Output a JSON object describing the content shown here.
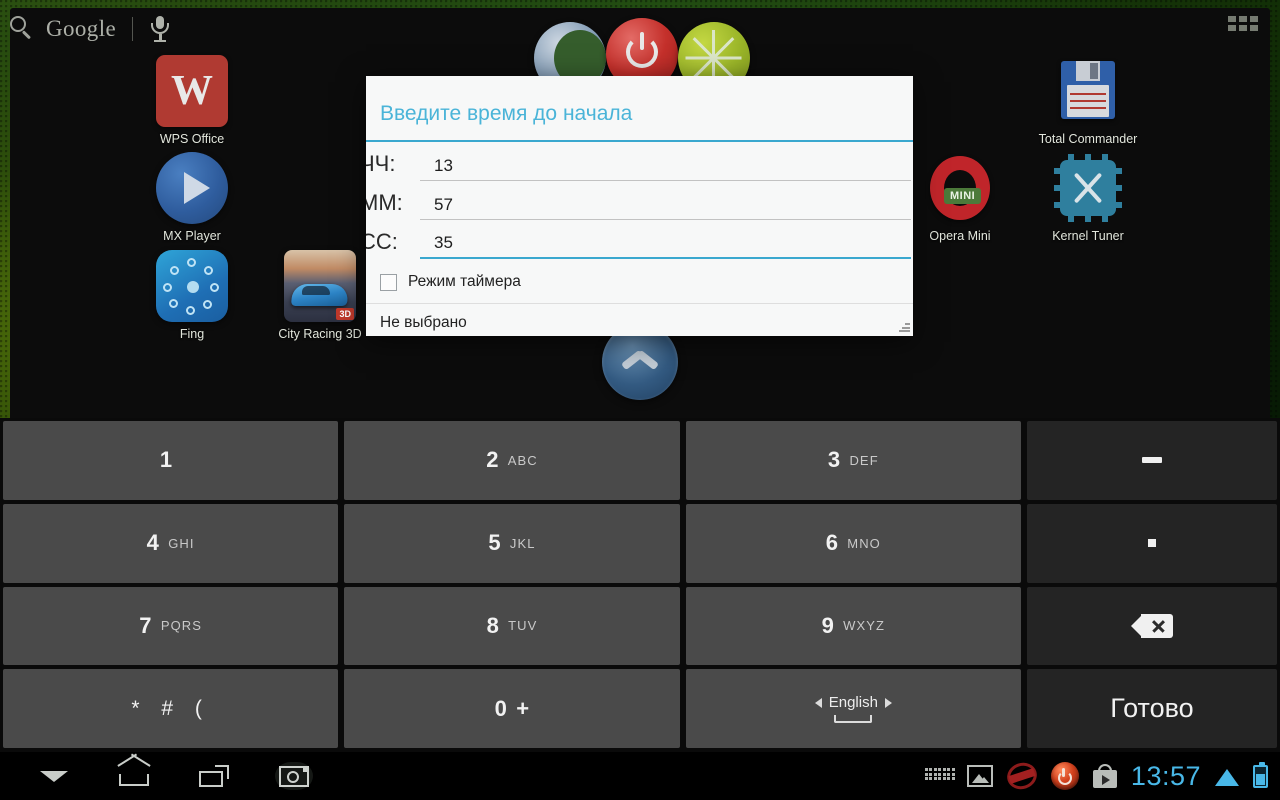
{
  "search": {
    "brand": "Google",
    "search_icon": "search-icon",
    "mic_icon": "microphone-icon"
  },
  "drawer": {
    "icon": "apps-grid-icon"
  },
  "desktop": {
    "icons": [
      {
        "label": "WPS Office",
        "name": "app-icon-wps-office"
      },
      {
        "label": "MX Player",
        "name": "app-icon-mx-player"
      },
      {
        "label": "Fing",
        "name": "app-icon-fing"
      },
      {
        "label": "City Racing 3D",
        "name": "app-icon-city-racing-3d",
        "badge": "3D"
      },
      {
        "label": "Total Commander",
        "name": "app-icon-total-commander"
      },
      {
        "label": "Opera Mini",
        "name": "app-icon-opera-mini",
        "badge": "MINI"
      },
      {
        "label": "Kernel Tuner",
        "name": "app-icon-kernel-tuner"
      }
    ],
    "dock_handle_icon": "chevron-up-icon"
  },
  "dialog": {
    "title": "Введите время до начала",
    "fields": [
      {
        "label": "ЧЧ:",
        "value": "13",
        "active": false
      },
      {
        "label": "ММ:",
        "value": "57",
        "active": false
      },
      {
        "label": "СС:",
        "value": "35",
        "active": true
      }
    ],
    "checkbox": {
      "label": "Режим таймера",
      "checked": false
    },
    "footer_text": "Не выбрано",
    "resize_icon": "resize-grip-icon",
    "accent_color": "#3aa8cf",
    "title_color": "#4ab4d8"
  },
  "keyboard": {
    "rows": [
      [
        {
          "digit": "1",
          "sub": "",
          "type": "num",
          "name": "key-1"
        },
        {
          "digit": "2",
          "sub": "ABC",
          "type": "num",
          "name": "key-2"
        },
        {
          "digit": "3",
          "sub": "DEF",
          "type": "num",
          "name": "key-3"
        },
        {
          "digit": "",
          "sub": "",
          "type": "side",
          "glyph": "dash-icon",
          "name": "key-dash"
        }
      ],
      [
        {
          "digit": "4",
          "sub": "GHI",
          "type": "num",
          "name": "key-4"
        },
        {
          "digit": "5",
          "sub": "JKL",
          "type": "num",
          "name": "key-5"
        },
        {
          "digit": "6",
          "sub": "MNO",
          "type": "num",
          "name": "key-6"
        },
        {
          "digit": "",
          "sub": "",
          "type": "side",
          "glyph": "period-icon",
          "name": "key-period"
        }
      ],
      [
        {
          "digit": "7",
          "sub": "PQRS",
          "type": "num",
          "name": "key-7"
        },
        {
          "digit": "8",
          "sub": "TUV",
          "type": "num",
          "name": "key-8"
        },
        {
          "digit": "9",
          "sub": "WXYZ",
          "type": "num",
          "name": "key-9"
        },
        {
          "digit": "",
          "sub": "",
          "type": "side",
          "glyph": "backspace-icon",
          "name": "key-backspace"
        }
      ],
      [
        {
          "digit": "",
          "sub": "",
          "type": "num",
          "sym": "* # (",
          "name": "key-symbols"
        },
        {
          "digit": "0",
          "sub": "+",
          "type": "num",
          "name": "key-0"
        },
        {
          "digit": "",
          "sub": "",
          "type": "num",
          "lang": "English",
          "name": "key-language"
        },
        {
          "digit": "",
          "sub": "",
          "type": "side",
          "done": "Готово",
          "name": "key-done"
        }
      ]
    ],
    "language_label": "English"
  },
  "systembar": {
    "nav": [
      {
        "name": "nav-back-hide-keyboard",
        "icon": "chevron-down-icon"
      },
      {
        "name": "nav-home",
        "icon": "home-icon"
      },
      {
        "name": "nav-recent-apps",
        "icon": "recent-apps-icon"
      },
      {
        "name": "nav-screenshot",
        "icon": "camera-icon"
      }
    ],
    "status_icons": [
      {
        "name": "status-keyboard",
        "icon": "keyboard-icon"
      },
      {
        "name": "status-screenshot",
        "icon": "image-icon"
      },
      {
        "name": "status-update",
        "icon": "update-stamp-icon"
      },
      {
        "name": "status-reboot",
        "icon": "power-button-icon"
      },
      {
        "name": "status-play-store",
        "icon": "play-store-icon"
      }
    ],
    "clock": "13:57",
    "wifi_icon": "wifi-icon",
    "battery_icon": "battery-icon"
  }
}
